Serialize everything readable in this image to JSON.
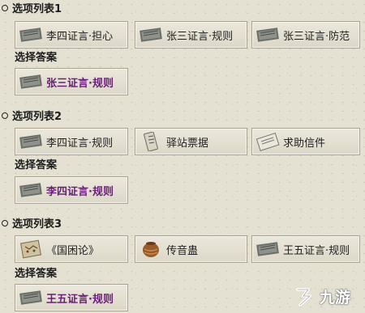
{
  "sections": [
    {
      "title": "选项列表1",
      "options": [
        {
          "label": "李四证言·担心",
          "icon": "scroll-book-icon"
        },
        {
          "label": "张三证言·规则",
          "icon": "scroll-book-icon"
        },
        {
          "label": "张三证言·防范",
          "icon": "scroll-book-icon"
        }
      ],
      "answer_title": "选择答案",
      "answer": {
        "label": "张三证言·规则",
        "icon": "scroll-book-icon"
      }
    },
    {
      "title": "选项列表2",
      "options": [
        {
          "label": "李四证言·规则",
          "icon": "scroll-book-icon"
        },
        {
          "label": "驿站票据",
          "icon": "ticket-icon"
        },
        {
          "label": "求助信件",
          "icon": "letter-icon"
        }
      ],
      "answer_title": "选择答案",
      "answer": {
        "label": "李四证言·规则",
        "icon": "scroll-book-icon"
      }
    },
    {
      "title": "选项列表3",
      "options": [
        {
          "label": "《国困论》",
          "icon": "map-scroll-icon"
        },
        {
          "label": "传音蛊",
          "icon": "jar-icon"
        },
        {
          "label": "王五证言·规则",
          "icon": "scroll-book-icon"
        }
      ],
      "answer_title": "选择答案",
      "answer": {
        "label": "王五证言·规则",
        "icon": "scroll-book-icon"
      }
    }
  ],
  "watermark": {
    "text": "九游",
    "icon": "j9-logo-icon"
  },
  "colors": {
    "answer_text": "#6b1d7a",
    "card_border": "#a8a491",
    "background": "#e4e1d3"
  }
}
